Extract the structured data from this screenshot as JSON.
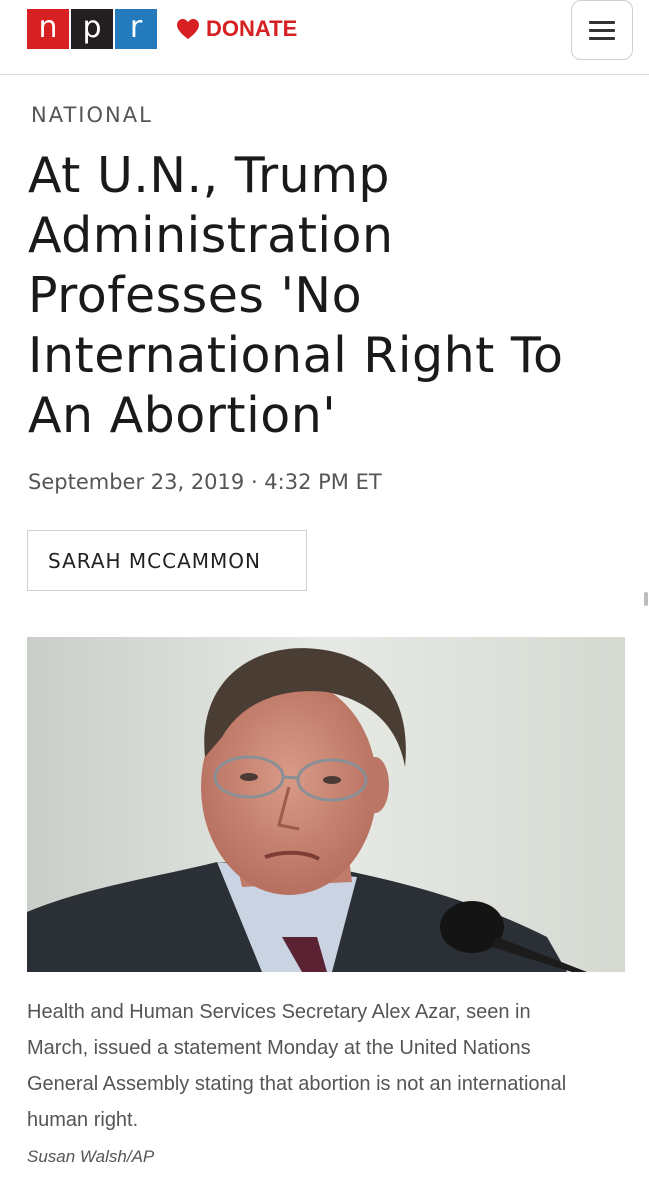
{
  "header": {
    "logo_letters": [
      "n",
      "p",
      "r"
    ],
    "donate_label": "DONATE",
    "brand_colors": {
      "n": "#d62021",
      "p": "#231f20",
      "r": "#237bbd",
      "donate": "#d62021"
    }
  },
  "article": {
    "section": "NATIONAL",
    "headline_lines": [
      "At U.N., Trump",
      "Administration",
      "Professes 'No",
      "International Right To",
      "An Abortion'"
    ],
    "dateline": "September 23, 2019 · 4:32 PM ET",
    "byline": "SARAH MCCAMMON",
    "image": {
      "caption_lines": [
        "Health and Human Services Secretary Alex Azar, seen in",
        "March, issued a statement Monday at the United Nations",
        "General Assembly stating that abortion is not an international",
        "human right."
      ],
      "credit": "Susan Walsh/AP"
    }
  },
  "icons": {
    "donate": "heart-icon",
    "menu": "hamburger-menu-icon"
  }
}
